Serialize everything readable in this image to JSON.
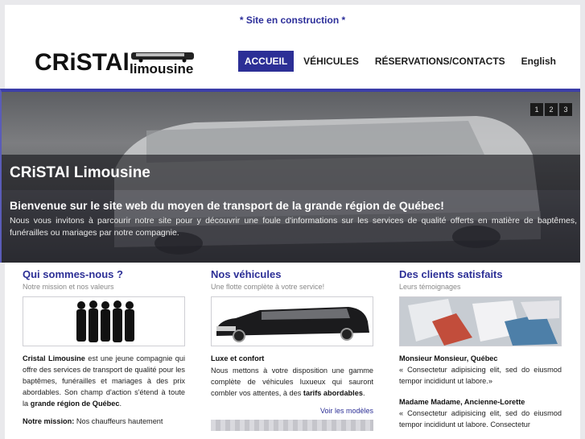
{
  "notice": "* Site en construction *",
  "logo": {
    "brand": "CRiSTAl",
    "sub": "limousine"
  },
  "nav": [
    {
      "label": "ACCUEIL",
      "active": true
    },
    {
      "label": "VÉHICULES",
      "active": false
    },
    {
      "label": "RÉSERVATIONS/CONTACTS",
      "active": false
    },
    {
      "label": "English",
      "active": false
    }
  ],
  "hero": {
    "title": "CRiSTAl Limousine",
    "subtitle": "Bienvenue sur le site web du moyen de transport de la grande région de Québec!",
    "text": "Nous vous invitons à parcourir notre site pour y découvrir une foule d'informations sur les services de qualité offerts en matière de baptêmes, funérailles ou mariages par notre compagnie.",
    "pager": [
      "1",
      "2",
      "3"
    ]
  },
  "columns": {
    "about": {
      "title": "Qui sommes-nous ?",
      "tagline": "Notre mission et nos valeurs",
      "p1_bold": "Cristal Limousine",
      "p1_text": " est une jeune compagnie qui offre des services de transport de qualité pour les baptêmes, funérailles et mariages à des prix abordables. Son champ d'action s'étend à toute la ",
      "p1_bold2": "grande région de Québec",
      "p1_end": ".",
      "p2_bold": "Notre mission:",
      "p2_text": " Nos chauffeurs hautement"
    },
    "vehicles": {
      "title": "Nos véhicules",
      "tagline": "Une flotte complète à votre service!",
      "heading": "Luxe et confort",
      "text": "Nous mettons à votre disposition une gamme complète de véhicules luxueux qui sauront combler vos attentes, à des ",
      "text_bold": "tarifs abordables",
      "text_end": ".",
      "more": "Voir les modèles"
    },
    "clients": {
      "title": "Des clients satisfaits",
      "tagline": "Leurs témoignages",
      "t1_name": "Monsieur Monsieur, Québec",
      "t1_text": "« Consectetur adipisicing elit, sed do eiusmod tempor incididunt ut labore.»",
      "t2_name": "Madame Madame, Ancienne-Lorette",
      "t2_text": "« Consectetur adipisicing elit, sed do eiusmod tempor incididunt ut labore. Consectetur"
    }
  },
  "colors": {
    "accent": "#2c2f96",
    "notice": "#2d2f9a"
  }
}
